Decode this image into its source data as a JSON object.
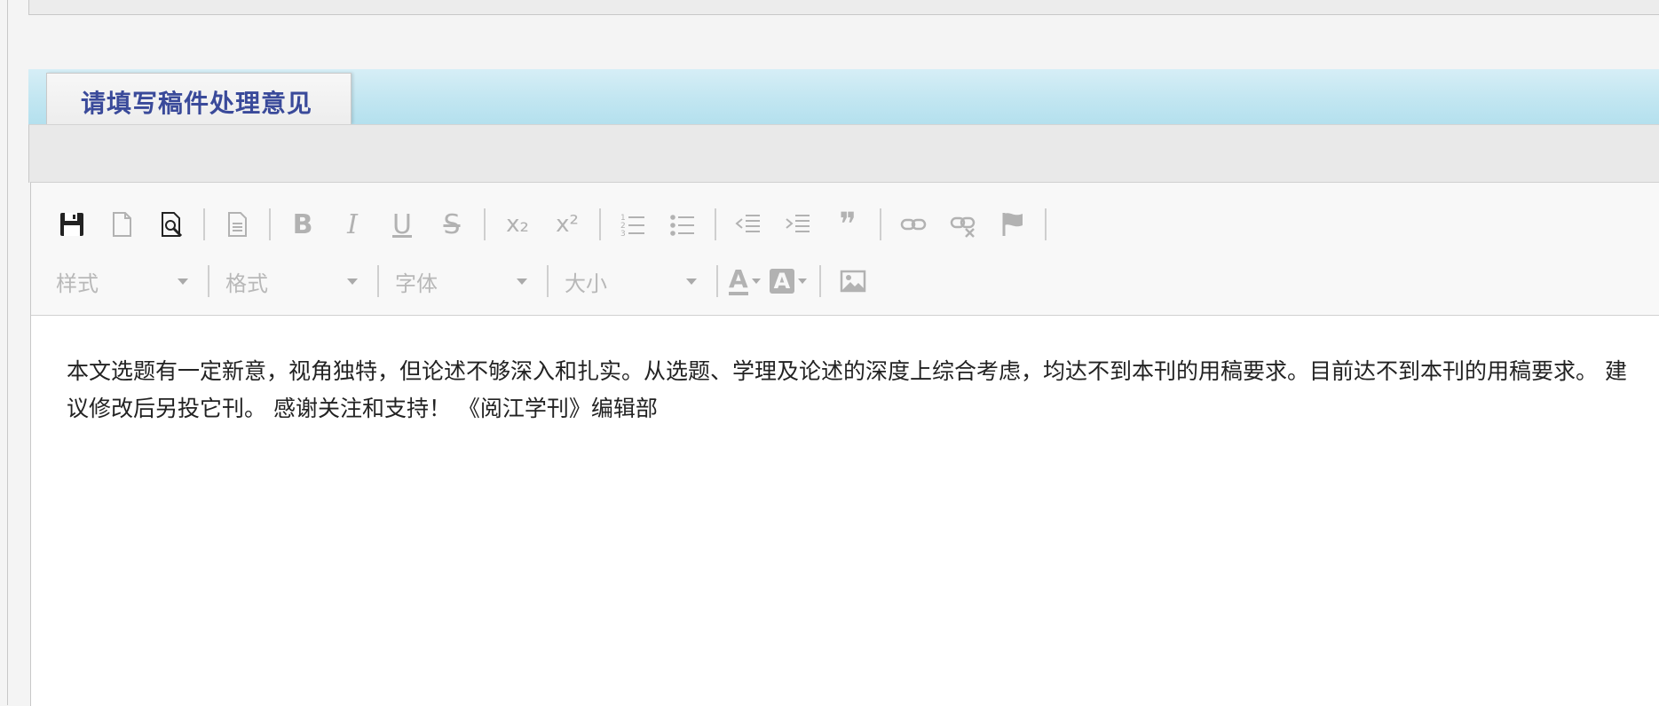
{
  "section": {
    "title": "请填写稿件处理意见"
  },
  "toolbar": {
    "row1": [
      {
        "icon": "save-icon"
      },
      {
        "icon": "new-page-icon"
      },
      {
        "icon": "preview-icon"
      },
      {
        "icon": "templates-icon"
      },
      {
        "icon": "bold-icon",
        "glyph": "B"
      },
      {
        "icon": "italic-icon",
        "glyph": "I"
      },
      {
        "icon": "underline-icon",
        "glyph": "U"
      },
      {
        "icon": "strikethrough-icon",
        "glyph": "S"
      },
      {
        "icon": "subscript-icon",
        "glyph": "x₂"
      },
      {
        "icon": "superscript-icon",
        "glyph": "x²"
      },
      {
        "icon": "numbered-list-icon"
      },
      {
        "icon": "bulleted-list-icon"
      },
      {
        "icon": "outdent-icon"
      },
      {
        "icon": "indent-icon"
      },
      {
        "icon": "blockquote-icon",
        "glyph": "❞"
      },
      {
        "icon": "link-icon"
      },
      {
        "icon": "unlink-icon"
      },
      {
        "icon": "anchor-flag-icon"
      }
    ],
    "combos": {
      "style": "样式",
      "format": "格式",
      "font": "字体",
      "size": "大小"
    },
    "text_color_glyph": "A",
    "bg_color_glyph": "A"
  },
  "content": {
    "text": "本文选题有一定新意，视角独特，但论述不够深入和扎实。从选题、学理及论述的深度上综合考虑，均达不到本刊的用稿要求。目前达不到本刊的用稿要求。 建议修改后另投它刊。 感谢关注和支持！ 《阅江学刊》编辑部"
  },
  "colors": {
    "section_title": "#3a4a9a",
    "section_bar": "#c2e6f1",
    "toolbar_bg": "#f8f8f8",
    "icon_disabled": "#b2b2b2",
    "icon_active": "#222222"
  }
}
